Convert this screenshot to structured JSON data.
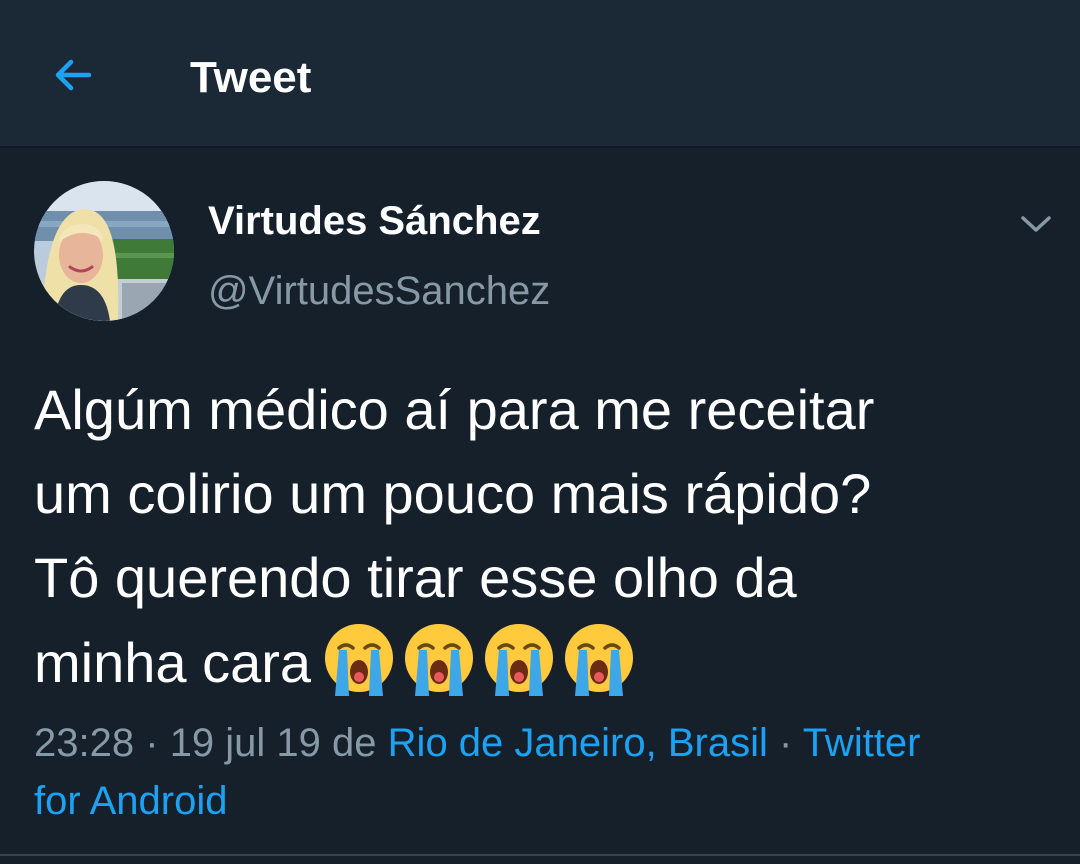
{
  "app_bar": {
    "title": "Tweet",
    "back_icon": "arrow-left-icon"
  },
  "colors": {
    "background": "#15202b",
    "app_bar": "#1b2836",
    "accent": "#1da1f2",
    "secondary_text": "#8899a6",
    "primary_text": "#ffffff"
  },
  "tweet": {
    "author": {
      "display_name": "Virtudes Sánchez",
      "handle": "@VirtudesSanchez",
      "avatar_icon": "user-avatar"
    },
    "more_icon": "chevron-down-icon",
    "text_lines": [
      "Algúm médico aí para me receitar",
      "um colirio um pouco mais rápido?",
      "Tô querendo tirar esse olho da",
      "minha cara"
    ],
    "emojis": [
      "😭",
      "😭",
      "😭",
      "😭"
    ],
    "emoji_icon": "loudly-crying-face-icon",
    "meta": {
      "time": "23:28",
      "separator": "·",
      "date": "19 jul 19",
      "from_word": "de",
      "location": "Rio de Janeiro, Brasil",
      "source_part1": "Twitter",
      "source_part2": "for Android"
    }
  }
}
